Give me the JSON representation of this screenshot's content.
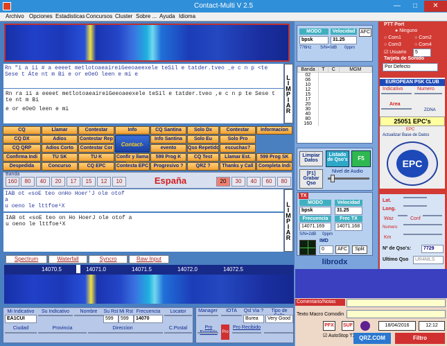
{
  "window": {
    "title": "Contact-Multi V 2.5"
  },
  "menu": [
    "Archivo",
    "Opciones",
    "Estadisticas",
    "Concursos",
    "Cluster",
    "Sobre ...",
    "Ayuda",
    "Idioma"
  ],
  "rx": {
    "line1": "Rn \"i a ii  # a eeeet  metlotoaeaireiGeeoaeexele teSil e tatder.tveo _e  c n p <te Sese  t Áte    nt m Bi  e or eOeO leen  e mi e",
    "main1": "Rn ra ii   a eeeet  metlotoaeaireiGeeoaeexele teSil e tatder.tveo ,e  c n p te Sese  t te     nt m Bi",
    "main2": "e or eOeO leen  e mi",
    "limpiar": "LIMPIAR"
  },
  "macros": [
    [
      "CQ",
      "Llamar",
      "Contestar",
      "Info",
      "CQ Santina",
      "Solo Dx",
      "Contestar",
      "Informacion"
    ],
    [
      "CQ DX",
      "Adios",
      "Contestar Rep",
      "",
      "Info Santina",
      "Solo Eu",
      "Solo Pro"
    ],
    [
      "CQ QRP",
      "Adios Corto",
      "Contestar Cor",
      "",
      "evento",
      "Qso Repetido",
      "escuchas?"
    ],
    [
      "Confirma Indi",
      "TU SK",
      "TU K",
      "Confir y llama",
      "599 Prog K",
      "CQ Test",
      "Llamar Est.",
      "599 Prog SK"
    ],
    [
      "Despedida",
      "Concurso",
      "CQ EPC",
      "Contesta EPC",
      "Progresivo ?",
      "QRZ ?",
      "Thanks y Call",
      "Completa Indi"
    ]
  ],
  "logo_text": "Contact-Multi",
  "banda": {
    "label": "Banda",
    "buttons": [
      "160",
      "80",
      "40",
      "20",
      "17",
      "15",
      "12",
      "10"
    ],
    "right": [
      "20",
      "30",
      "40",
      "60",
      "80",
      "160"
    ],
    "selected": "20",
    "country": "España"
  },
  "tx": {
    "line1": "IAB ot    «soE   teo onHo    Hoer'J  ole  otof",
    "line2": "a",
    "line3": "u oeno le lttfoe¹X",
    "main1": "IAB ot    «soE  teo on Ho HoerJ  ole  otof a",
    "main2": "u oeno le lttfoe¹X",
    "limpiar": "LIMPIAR"
  },
  "tabs": [
    "Spectrum",
    "Waterfall",
    "Syncro",
    "Raw Input"
  ],
  "freq_ticks": [
    "14070.5",
    "14071.0",
    "14071.5",
    "14072.0",
    "14072.5"
  ],
  "bottom": {
    "headers": [
      "Mi Indicativo",
      "Su Indicativo",
      "Nombre",
      "Su Rst",
      "Mi Rst",
      "Frecuencia",
      "Locator"
    ],
    "values": [
      "EA1CUI",
      "",
      "",
      "599",
      "599",
      "14070",
      ""
    ],
    "headers2": [
      "Ciudad",
      "Provincia",
      "Direccion",
      "C.Postal"
    ]
  },
  "bottom2": {
    "manager": "Manager",
    "iota": "IOTA",
    "qslvia": "Qsl Via ?",
    "tipo": "Tipo de Sello",
    "bureau": "Burea",
    "verygood": "Very Good",
    "pro_env": "Pro Enviado",
    "pro_rec": "Pro Recibido",
    "pro": "Pro"
  },
  "mode": {
    "modo": "MODO",
    "velocidad": "Velocidad",
    "afc": "AFC",
    "mode_val": "bpsk",
    "speed_val": "31.25",
    "hz": "776Hz",
    "sn": "S/N=0dB",
    "ppm": "0ppm"
  },
  "bands_table": {
    "headers": [
      "Banda",
      "T",
      "C",
      "MGM"
    ],
    "rows": [
      "02",
      "06",
      "10",
      "12",
      "15",
      "17",
      "20",
      "30",
      "40",
      "80",
      "160"
    ]
  },
  "controls": {
    "limpiar_datos": "Limpiar Datos",
    "listado": "Listado de Qso's",
    "f5": "F5",
    "f5b": "F5",
    "grabar": "[F1] Grabar Qso",
    "nivel": "Nivel de Audio"
  },
  "ptt": {
    "title": "PTT Port",
    "ninguno": "Ninguno",
    "com1": "Com1",
    "com2": "Com2",
    "com3": "Com3",
    "com4": "Com4",
    "usuario": "Usuario",
    "usuario_val": "5",
    "tarjeta": "Tarjeta de Sonido",
    "defecto": "Por Defecto"
  },
  "epc": {
    "club": "EUROPEAN PSK CLUB",
    "indicativo": "Indicativo",
    "numero": "Numero",
    "area": "Area",
    "zona": "ZONA",
    "count": "25051 EPC's",
    "epc": "EPC",
    "actualizar": "Actualizar Base de Datos",
    "ring": "PHASE · SHIFT · KEYING · CLUB · EUROPEAN",
    "center": "EPC"
  },
  "tx_mode": {
    "tx": "TX",
    "modo": "MODO",
    "velocidad": "Velocidad",
    "frecuencia": "Frecuencia",
    "frec_tx": "Frec TX",
    "mode_val": "bpsk",
    "speed_val": "31.25",
    "f1": "14071.169",
    "f2": "14071.168",
    "sn": "S/N=2dB",
    "ppm": "0ppm",
    "imd": "IMD",
    "imd_val": "0",
    "afc": "AFC",
    "split": "Split",
    "librodx": "librodx"
  },
  "info": {
    "lat": "Lat.",
    "long": "Long.",
    "waz": "Waz",
    "conf": "Conf",
    "numero": "Numero",
    "km": "Km",
    "qsos_label": "Nº de Qso's:",
    "qsos": "7729",
    "ultimo_label": "Ultimo Qso",
    "ultimo": "UR4MLS"
  },
  "status": {
    "comentario": "Comentario/Notas",
    "texto_macro": "Texto Macro Comodin",
    "pfx": "PFX",
    "suf": "SUF",
    "date": "18/04/2016",
    "time": "12:12",
    "autostop": "AutoStop TX",
    "qrz": "QRZ.COM",
    "filtro": "Filtro"
  }
}
